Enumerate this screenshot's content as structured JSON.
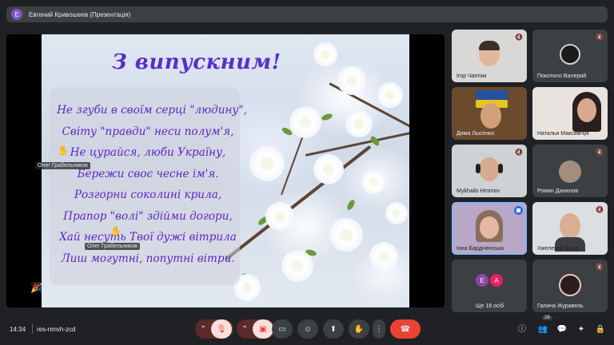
{
  "topbar": {
    "avatar_letter": "E",
    "title": "Евгений Кривошеев (Презентація)"
  },
  "slide": {
    "title": "З випускним!",
    "poem": [
      "Не згуби в своїм серці \"людину\",",
      "Світу \"правди\" неси полум'я,",
      "Не цурайся, люби Україну,",
      "Бережи своє чесне ім'я.",
      "Розгорни соколині крила,",
      "Прапор \"волі\" здійми догори,",
      "Хай несуть Твої дужі вітрила",
      "Лиш могутні, попутні вітри."
    ]
  },
  "stage_tags": {
    "tag1": "Олег Грабельников",
    "tag2": "Олег Грабельников"
  },
  "tiles": [
    {
      "name": "Ігор Чаплик"
    },
    {
      "name": "Покотило Валерий"
    },
    {
      "name": "Дима Лысенко"
    },
    {
      "name": "Наталья Максимчук"
    },
    {
      "name": "Mykhailo Hromov"
    },
    {
      "name": "Роман Данилов"
    },
    {
      "name": "Інна Бардіченська"
    },
    {
      "name": "Хмелевой Влад"
    },
    {
      "name": "Ще 18 осіб",
      "avatars": [
        "E",
        "A"
      ]
    },
    {
      "name": "Галина Журавель"
    }
  ],
  "bottombar": {
    "time": "14:34",
    "meeting_code": "res-nmvh-zcd",
    "participants_count": "28"
  },
  "colors": {
    "accent": "#8ab4f8",
    "end_call": "#ea4335",
    "slide_text": "#5826c4"
  }
}
